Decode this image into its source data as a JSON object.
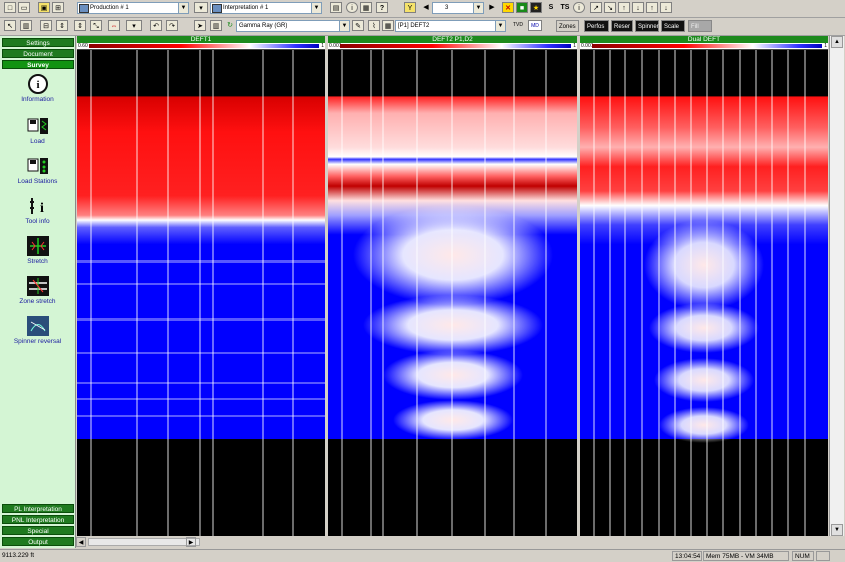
{
  "toolbar1": {
    "production_combo": "Production # 1",
    "interpretation_combo": "Interpretation # 1",
    "nav_value": "3",
    "s_label": "S",
    "ts_label": "TS"
  },
  "toolbar2": {
    "channel_combo": "Gamma Ray (GR)",
    "pass_combo": "[P1] DEFT2",
    "tvd_label": "TVD",
    "md_label": "MD",
    "zones_label": "Zones",
    "buttons": [
      "Perfos",
      "Reser",
      "Spinner",
      "Scale",
      "Fill"
    ]
  },
  "sidebar": {
    "sections_top": [
      "Settings",
      "Document",
      "Survey"
    ],
    "active_section": "Survey",
    "items": [
      {
        "label": "Information",
        "icon": "info-icon"
      },
      {
        "label": "Load",
        "icon": "load-icon"
      },
      {
        "label": "Load Stations",
        "icon": "load-stations-icon"
      },
      {
        "label": "Tool info",
        "icon": "tool-info-icon"
      },
      {
        "label": "Stretch",
        "icon": "stretch-icon"
      },
      {
        "label": "Zone stretch",
        "icon": "zone-stretch-icon"
      },
      {
        "label": "Spinner reversal",
        "icon": "spinner-reversal-icon"
      }
    ],
    "sections_bottom": [
      "PL Interpretation",
      "PNL Interpretation",
      "Special",
      "Output"
    ]
  },
  "tracks": [
    {
      "title": "DEFT1",
      "scale_lo": "0.60",
      "scale_hi": "1"
    },
    {
      "title": "DEFT2 P1,D2",
      "scale_lo": "0.001",
      "scale_hi": "1"
    },
    {
      "title": "Dual DEFT",
      "scale_lo": "0.001",
      "scale_hi": "1"
    }
  ],
  "status": {
    "depth": "9113.229 ft",
    "time": "13:04:54",
    "memory": "Mem 75MB - VM 34MB",
    "num": "NUM"
  }
}
